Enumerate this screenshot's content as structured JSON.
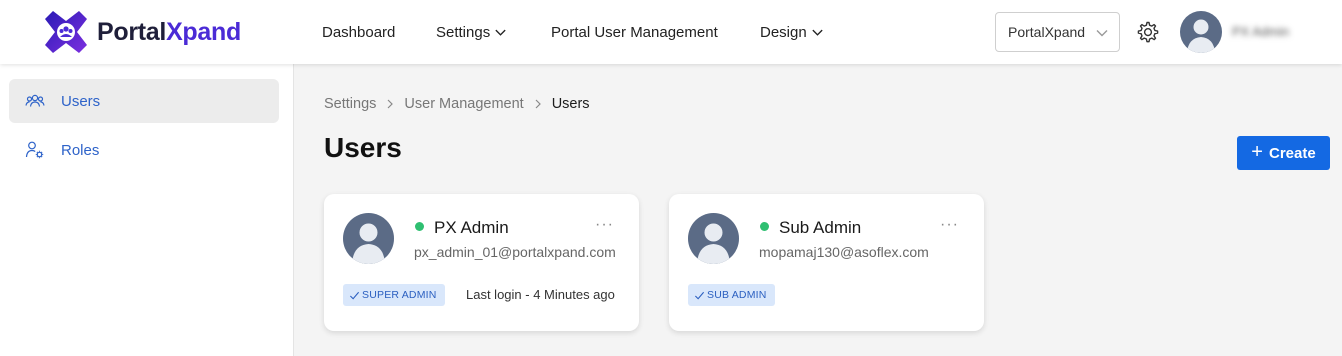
{
  "brand": {
    "name_part1": "Portal",
    "name_part2": "Xpand",
    "logo_color": "#4b2bd6"
  },
  "nav": {
    "dashboard": "Dashboard",
    "settings": "Settings",
    "portal_user_management": "Portal User Management",
    "design": "Design"
  },
  "header": {
    "tenant_value": "PortalXpand",
    "user_name": "PX Admin"
  },
  "sidebar": {
    "items": [
      {
        "label": "Users",
        "icon": "users-icon",
        "active": true
      },
      {
        "label": "Roles",
        "icon": "user-settings-icon",
        "active": false
      }
    ]
  },
  "breadcrumb": [
    "Settings",
    "User Management",
    "Users"
  ],
  "page": {
    "title": "Users",
    "create_label": "Create",
    "accent_color": "#1469e3"
  },
  "users": [
    {
      "name": "PX Admin",
      "email": "px_admin_01@portalxpand.com",
      "role": "SUPER ADMIN",
      "last_login": "Last login - 4 Minutes ago",
      "status": "online",
      "menu": "···"
    },
    {
      "name": "Sub Admin",
      "email": "mopamaj130@asoflex.com",
      "role": "SUB ADMIN",
      "last_login": "",
      "status": "online",
      "menu": "···"
    }
  ],
  "colors": {
    "status_online": "#2fbf71",
    "badge_bg": "#d9e7fb",
    "badge_text": "#2b5fc0",
    "sidebar_link": "#2e63c9"
  }
}
